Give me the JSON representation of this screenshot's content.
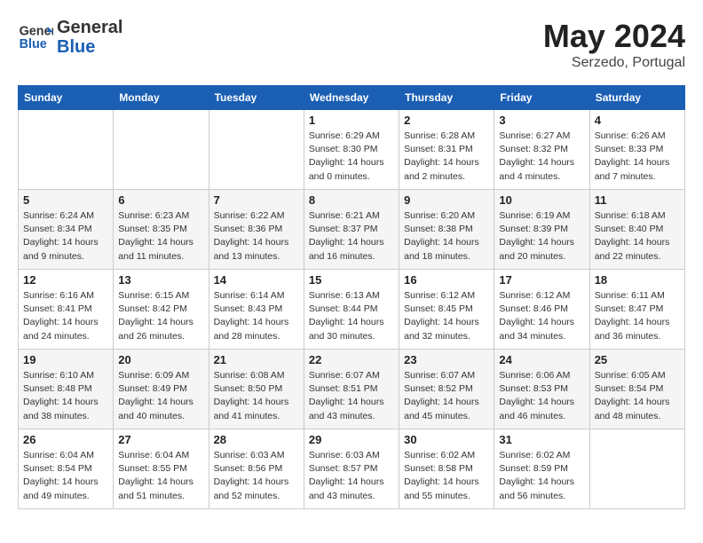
{
  "header": {
    "logo_line1": "General",
    "logo_line2": "Blue",
    "month": "May 2024",
    "location": "Serzedo, Portugal"
  },
  "weekdays": [
    "Sunday",
    "Monday",
    "Tuesday",
    "Wednesday",
    "Thursday",
    "Friday",
    "Saturday"
  ],
  "weeks": [
    [
      {
        "day": "",
        "info": ""
      },
      {
        "day": "",
        "info": ""
      },
      {
        "day": "",
        "info": ""
      },
      {
        "day": "1",
        "info": "Sunrise: 6:29 AM\nSunset: 8:30 PM\nDaylight: 14 hours\nand 0 minutes."
      },
      {
        "day": "2",
        "info": "Sunrise: 6:28 AM\nSunset: 8:31 PM\nDaylight: 14 hours\nand 2 minutes."
      },
      {
        "day": "3",
        "info": "Sunrise: 6:27 AM\nSunset: 8:32 PM\nDaylight: 14 hours\nand 4 minutes."
      },
      {
        "day": "4",
        "info": "Sunrise: 6:26 AM\nSunset: 8:33 PM\nDaylight: 14 hours\nand 7 minutes."
      }
    ],
    [
      {
        "day": "5",
        "info": "Sunrise: 6:24 AM\nSunset: 8:34 PM\nDaylight: 14 hours\nand 9 minutes."
      },
      {
        "day": "6",
        "info": "Sunrise: 6:23 AM\nSunset: 8:35 PM\nDaylight: 14 hours\nand 11 minutes."
      },
      {
        "day": "7",
        "info": "Sunrise: 6:22 AM\nSunset: 8:36 PM\nDaylight: 14 hours\nand 13 minutes."
      },
      {
        "day": "8",
        "info": "Sunrise: 6:21 AM\nSunset: 8:37 PM\nDaylight: 14 hours\nand 16 minutes."
      },
      {
        "day": "9",
        "info": "Sunrise: 6:20 AM\nSunset: 8:38 PM\nDaylight: 14 hours\nand 18 minutes."
      },
      {
        "day": "10",
        "info": "Sunrise: 6:19 AM\nSunset: 8:39 PM\nDaylight: 14 hours\nand 20 minutes."
      },
      {
        "day": "11",
        "info": "Sunrise: 6:18 AM\nSunset: 8:40 PM\nDaylight: 14 hours\nand 22 minutes."
      }
    ],
    [
      {
        "day": "12",
        "info": "Sunrise: 6:16 AM\nSunset: 8:41 PM\nDaylight: 14 hours\nand 24 minutes."
      },
      {
        "day": "13",
        "info": "Sunrise: 6:15 AM\nSunset: 8:42 PM\nDaylight: 14 hours\nand 26 minutes."
      },
      {
        "day": "14",
        "info": "Sunrise: 6:14 AM\nSunset: 8:43 PM\nDaylight: 14 hours\nand 28 minutes."
      },
      {
        "day": "15",
        "info": "Sunrise: 6:13 AM\nSunset: 8:44 PM\nDaylight: 14 hours\nand 30 minutes."
      },
      {
        "day": "16",
        "info": "Sunrise: 6:12 AM\nSunset: 8:45 PM\nDaylight: 14 hours\nand 32 minutes."
      },
      {
        "day": "17",
        "info": "Sunrise: 6:12 AM\nSunset: 8:46 PM\nDaylight: 14 hours\nand 34 minutes."
      },
      {
        "day": "18",
        "info": "Sunrise: 6:11 AM\nSunset: 8:47 PM\nDaylight: 14 hours\nand 36 minutes."
      }
    ],
    [
      {
        "day": "19",
        "info": "Sunrise: 6:10 AM\nSunset: 8:48 PM\nDaylight: 14 hours\nand 38 minutes."
      },
      {
        "day": "20",
        "info": "Sunrise: 6:09 AM\nSunset: 8:49 PM\nDaylight: 14 hours\nand 40 minutes."
      },
      {
        "day": "21",
        "info": "Sunrise: 6:08 AM\nSunset: 8:50 PM\nDaylight: 14 hours\nand 41 minutes."
      },
      {
        "day": "22",
        "info": "Sunrise: 6:07 AM\nSunset: 8:51 PM\nDaylight: 14 hours\nand 43 minutes."
      },
      {
        "day": "23",
        "info": "Sunrise: 6:07 AM\nSunset: 8:52 PM\nDaylight: 14 hours\nand 45 minutes."
      },
      {
        "day": "24",
        "info": "Sunrise: 6:06 AM\nSunset: 8:53 PM\nDaylight: 14 hours\nand 46 minutes."
      },
      {
        "day": "25",
        "info": "Sunrise: 6:05 AM\nSunset: 8:54 PM\nDaylight: 14 hours\nand 48 minutes."
      }
    ],
    [
      {
        "day": "26",
        "info": "Sunrise: 6:04 AM\nSunset: 8:54 PM\nDaylight: 14 hours\nand 49 minutes."
      },
      {
        "day": "27",
        "info": "Sunrise: 6:04 AM\nSunset: 8:55 PM\nDaylight: 14 hours\nand 51 minutes."
      },
      {
        "day": "28",
        "info": "Sunrise: 6:03 AM\nSunset: 8:56 PM\nDaylight: 14 hours\nand 52 minutes."
      },
      {
        "day": "29",
        "info": "Sunrise: 6:03 AM\nSunset: 8:57 PM\nDaylight: 14 hours\nand 43 minutes."
      },
      {
        "day": "30",
        "info": "Sunrise: 6:02 AM\nSunset: 8:58 PM\nDaylight: 14 hours\nand 55 minutes."
      },
      {
        "day": "31",
        "info": "Sunrise: 6:02 AM\nSunset: 8:59 PM\nDaylight: 14 hours\nand 56 minutes."
      },
      {
        "day": "",
        "info": ""
      }
    ]
  ]
}
